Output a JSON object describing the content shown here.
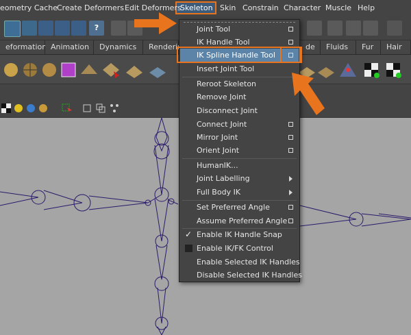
{
  "menubar": {
    "items": [
      {
        "label": "eometry Cache"
      },
      {
        "label": "Create Deformers"
      },
      {
        "label": "Edit Deformers"
      },
      {
        "label": "Skeleton"
      },
      {
        "label": "Skin"
      },
      {
        "label": "Constrain"
      },
      {
        "label": "Character"
      },
      {
        "label": "Muscle"
      },
      {
        "label": "Help"
      }
    ]
  },
  "shelf_tabs": [
    {
      "label": "eformation"
    },
    {
      "label": "Animation"
    },
    {
      "label": "Dynamics"
    },
    {
      "label": "Renderin"
    },
    {
      "label": "de"
    },
    {
      "label": "Fluids"
    },
    {
      "label": "Fur"
    },
    {
      "label": "Hair"
    }
  ],
  "skeleton_menu": {
    "items": [
      {
        "label": "Joint Tool"
      },
      {
        "label": "IK Handle Tool"
      },
      {
        "label": "IK Spline Handle Tool"
      },
      {
        "label": "Insert Joint Tool"
      },
      {
        "label": "Reroot Skeleton"
      },
      {
        "label": "Remove Joint"
      },
      {
        "label": "Disconnect Joint"
      },
      {
        "label": "Connect Joint"
      },
      {
        "label": "Mirror Joint"
      },
      {
        "label": "Orient Joint"
      },
      {
        "label": "HumanIK..."
      },
      {
        "label": "Joint Labelling"
      },
      {
        "label": "Full Body IK"
      },
      {
        "label": "Set Preferred Angle"
      },
      {
        "label": "Assume Preferred Angle"
      },
      {
        "label": "Enable IK Handle Snap"
      },
      {
        "label": "Enable IK/FK Control"
      },
      {
        "label": "Enable Selected IK Handles"
      },
      {
        "label": "Disable Selected IK Handles"
      }
    ]
  },
  "colors": {
    "annotation": "#e8741e",
    "highlight": "#5c84a8",
    "skeleton_wire": "#2a1a6a"
  }
}
